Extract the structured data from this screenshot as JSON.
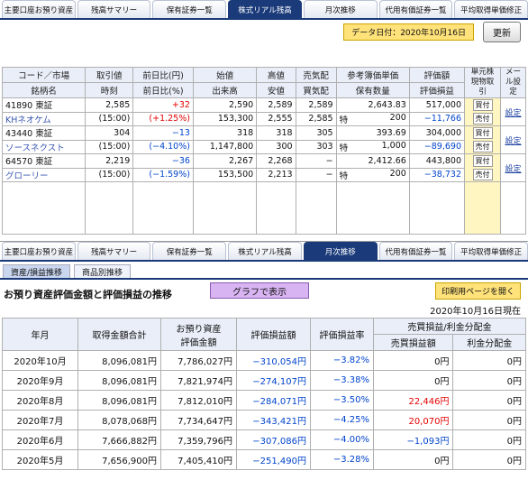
{
  "top_tabs": [
    "主要口座お預り資産",
    "残高サマリー",
    "保有証券一覧",
    "株式リアル残高",
    "月次推移",
    "代用有価証券一覧",
    "平均取得単価修正"
  ],
  "datebar": {
    "date_label": "データ日付：2020年10月16日",
    "refresh": "更新"
  },
  "holdings_headers": {
    "code_market": "コード／市場",
    "name": "銘柄名",
    "price": "取引値",
    "time": "時刻",
    "change": "前日比(円)",
    "change_pct": "前日比(%)",
    "open": "始値",
    "volume": "出来高",
    "high": "高値",
    "low": "安値",
    "sell_quote": "売気配",
    "buy_quote": "買気配",
    "ref_book": "参考簿価単価",
    "hold_qty": "保有数量",
    "eval_amount": "評価額",
    "eval_pl": "評価損益",
    "unit_trade": "単元株現物取引",
    "mail": "メール設定"
  },
  "holdings": [
    {
      "code": "41890",
      "market": "東証",
      "name": "KHネオケム",
      "price": "2,585",
      "time": "(15:00)",
      "change": "+32",
      "change_pct": "(+1.25%)",
      "open": "2,590",
      "volume": "153,300",
      "high": "2,589",
      "low": "2,555",
      "sell": "2,589",
      "buy": "2,585",
      "book": "2,643.83",
      "special": "特",
      "qty": "200",
      "eval": "517,000",
      "pl": "−11,766",
      "buy_btn": "買付",
      "sell_btn": "売付",
      "mail": "設定"
    },
    {
      "code": "43440",
      "market": "東証",
      "name": "ソースネクスト",
      "price": "304",
      "time": "(15:00)",
      "change": "−13",
      "change_pct": "(−4.10%)",
      "open": "318",
      "volume": "1,147,800",
      "high": "318",
      "low": "300",
      "sell": "305",
      "buy": "303",
      "book": "393.69",
      "special": "特",
      "qty": "1,000",
      "eval": "304,000",
      "pl": "−89,690",
      "buy_btn": "買付",
      "sell_btn": "売付",
      "mail": "設定"
    },
    {
      "code": "64570",
      "market": "東証",
      "name": "グローリー",
      "price": "2,219",
      "time": "(15:00)",
      "change": "−36",
      "change_pct": "(−1.59%)",
      "open": "2,267",
      "volume": "153,500",
      "high": "2,268",
      "low": "2,213",
      "sell": "−",
      "buy": "−",
      "book": "2,412.66",
      "special": "特",
      "qty": "200",
      "eval": "443,800",
      "pl": "−38,732",
      "buy_btn": "買付",
      "sell_btn": "売付",
      "mail": "設定"
    }
  ],
  "sub_tabs": [
    "資産/損益推移",
    "商品別推移"
  ],
  "section_title": "お預り資産評価金額と評価損益の推移",
  "graph_button": "グラフで表示",
  "print_button": "印刷用ページを開く",
  "as_of": "2020年10月16日現在",
  "history_headers": {
    "month": "年月",
    "acq": "取得金額合計",
    "asset1": "お預り資産",
    "asset2": "評価金額",
    "pl": "評価損益額",
    "pl_rate": "評価損益率",
    "group": "売買損益/利金分配金",
    "trade_pl": "売買損益額",
    "dividend": "利金分配金"
  },
  "history": [
    {
      "month": "2020年10月",
      "acq": "8,096,081円",
      "asset": "7,786,027円",
      "pl": "−310,054円",
      "rate": "−3.82%",
      "trade": "0円",
      "trade_color": "#111",
      "div": "0円"
    },
    {
      "month": "2020年9月",
      "acq": "8,096,081円",
      "asset": "7,821,974円",
      "pl": "−274,107円",
      "rate": "−3.38%",
      "trade": "0円",
      "trade_color": "#111",
      "div": "0円"
    },
    {
      "month": "2020年8月",
      "acq": "8,096,081円",
      "asset": "7,812,010円",
      "pl": "−284,071円",
      "rate": "−3.50%",
      "trade": "22,446円",
      "trade_color": "#e30000",
      "div": "0円"
    },
    {
      "month": "2020年7月",
      "acq": "8,078,068円",
      "asset": "7,734,647円",
      "pl": "−343,421円",
      "rate": "−4.25%",
      "trade": "20,070円",
      "trade_color": "#e30000",
      "div": "0円"
    },
    {
      "month": "2020年6月",
      "acq": "7,666,882円",
      "asset": "7,359,796円",
      "pl": "−307,086円",
      "rate": "−4.00%",
      "trade": "−1,093円",
      "trade_color": "#0044cc",
      "div": "0円"
    },
    {
      "month": "2020年5月",
      "acq": "7,656,900円",
      "asset": "7,405,410円",
      "pl": "−251,490円",
      "rate": "−3.28%",
      "trade": "0円",
      "trade_color": "#111",
      "div": "0円"
    }
  ]
}
